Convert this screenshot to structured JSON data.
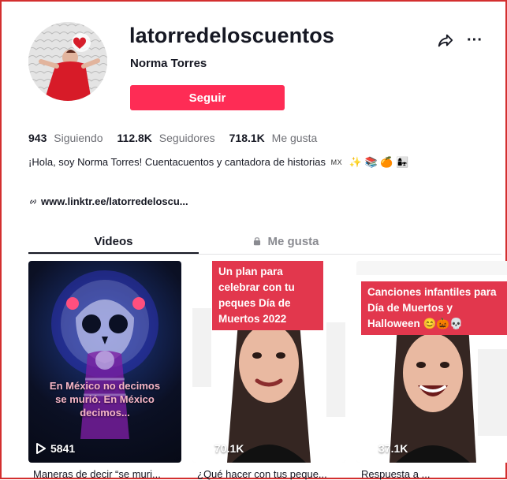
{
  "profile": {
    "username": "latorredeloscuentos",
    "display_name": "Norma Torres",
    "follow_label": "Seguir"
  },
  "stats": {
    "following": {
      "value": "943",
      "label": "Siguiendo"
    },
    "followers": {
      "value": "112.8K",
      "label": "Seguidores"
    },
    "likes": {
      "value": "718.1K",
      "label": "Me gusta"
    }
  },
  "bio": {
    "text": "¡Hola, soy Norma Torres! Cuentacuentos y cantadora de historias",
    "flag": "MX",
    "emojis": "✨ 📚 🍊 👩‍👧"
  },
  "link": {
    "text": "www.linktr.ee/latorredeloscu..."
  },
  "tabs": [
    {
      "label": "Videos",
      "selected": true
    },
    {
      "label": "Me gusta",
      "selected": false,
      "icon": "lock-icon"
    }
  ],
  "videos": [
    {
      "views": "5841",
      "caption": "Maneras de decir “se muri...",
      "overlay": "",
      "subtitle": "En México no decimos se murió. En México decimos..."
    },
    {
      "views": "70.1K",
      "caption": "¿Qué hacer con tus peque...",
      "overlay": "Un plan para celebrar con tu peques Día de Muertos 2022"
    },
    {
      "views": "37.1K",
      "caption": "Respuesta a ...",
      "overlay": "Canciones infantiles para Día de Muertos y Halloween 😊🎃💀"
    }
  ],
  "colors": {
    "accent": "#fe2c55",
    "border": "#d32f2f"
  },
  "icons": {
    "share": "share-icon",
    "more": "more-icon",
    "link": "link-icon",
    "play": "play-icon"
  }
}
